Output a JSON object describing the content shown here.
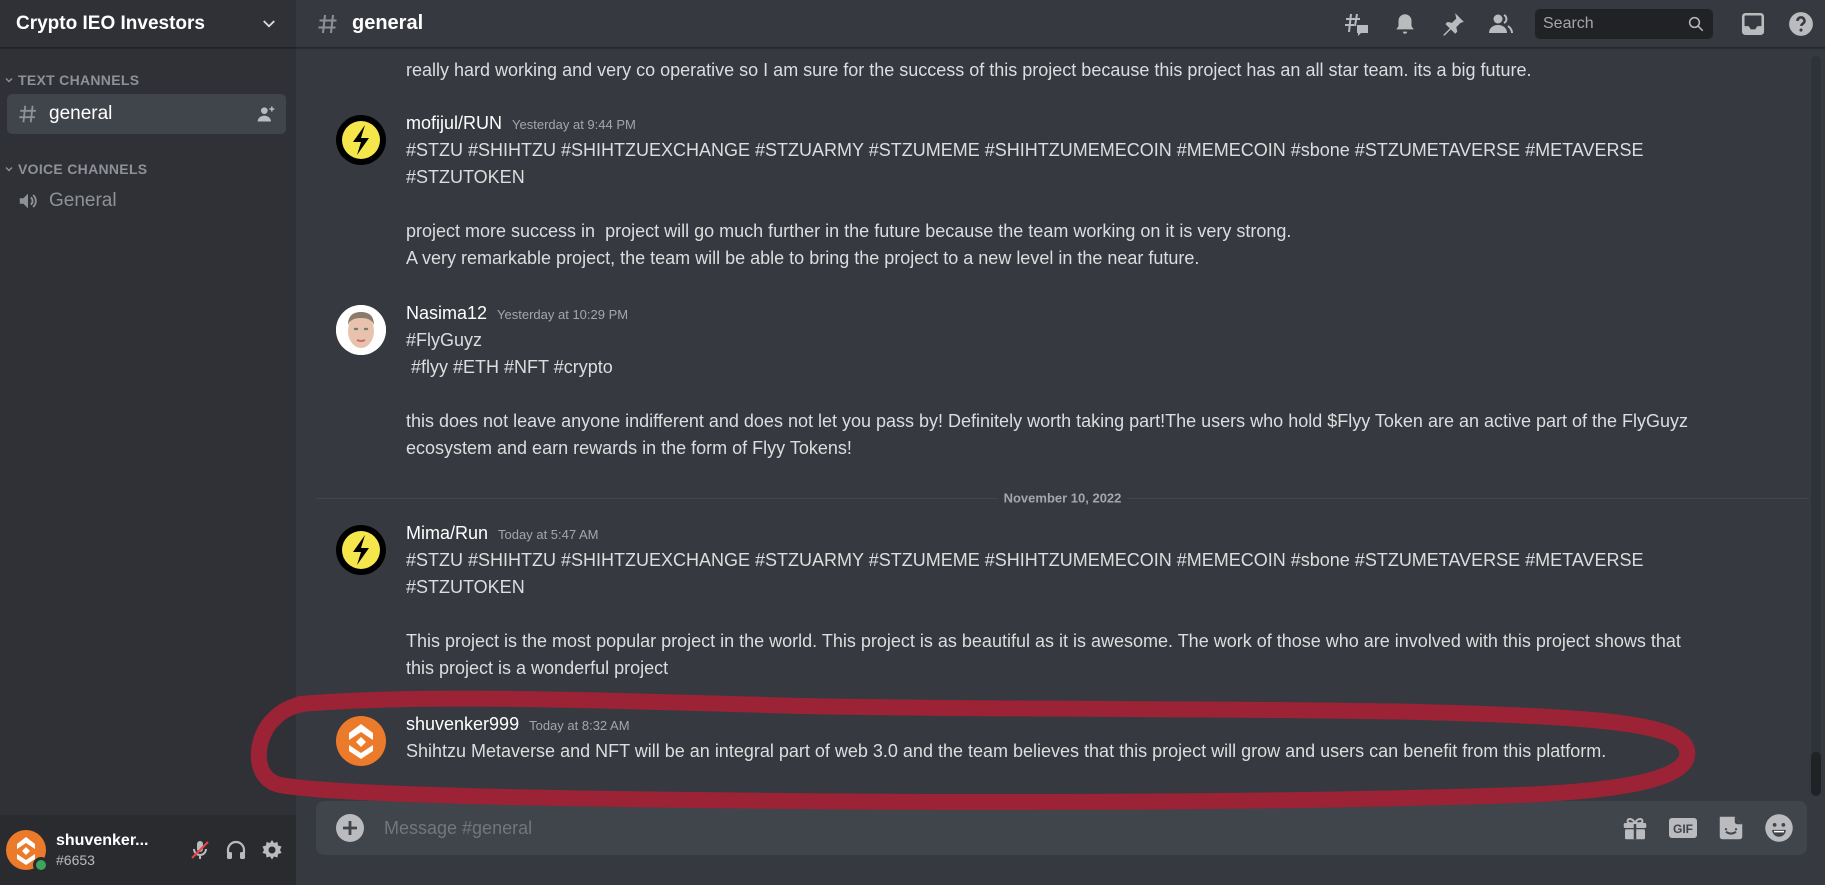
{
  "server": {
    "name": "Crypto IEO Investors"
  },
  "sidebar": {
    "categories": [
      {
        "label": "TEXT CHANNELS"
      },
      {
        "label": "VOICE CHANNELS"
      }
    ],
    "text_channels": [
      {
        "label": "general",
        "active": true
      }
    ],
    "voice_channels": [
      {
        "label": "General"
      }
    ]
  },
  "user_panel": {
    "username": "shuvenker...",
    "tag": "#6653",
    "status": "online"
  },
  "topbar": {
    "channel": "general",
    "icons": [
      "threads-icon",
      "notification-bell-icon",
      "pinned-messages-icon",
      "member-list-icon",
      "inbox-icon",
      "help-icon"
    ],
    "search_placeholder": "Search"
  },
  "messages": [
    {
      "continuation": true,
      "lines": [
        "really hard working and very co operative so I am sure for the success of this project because this project has an all star team. its a big future."
      ]
    },
    {
      "author": "mofijul/RUN",
      "time": "Yesterday at 9:44 PM",
      "avatar": "lightning-bolt",
      "lines": [
        "#STZU #SHIHTZU #SHIHTZUEXCHANGE #STZUARMY #STZUMEME #SHIHTZUMEMECOIN #MEMECOIN #sbone #STZUMETAVERSE #METAVERSE",
        "#STZUTOKEN",
        "",
        "project more success in  project will go much further in the future because the team working on it is very strong.",
        "A very remarkable project, the team will be able to bring the project to a new level in the near future."
      ]
    },
    {
      "author": "Nasima12",
      "time": "Yesterday at 10:29 PM",
      "avatar": "face-photo",
      "lines": [
        "#FlyGuyz",
        " #flyy #ETH #NFT #crypto",
        "",
        "this does not leave anyone indifferent and does not let you pass by! Definitely worth taking part!The users who hold $Flyy Token are an active part of the FlyGuyz",
        "ecosystem and earn rewards in the form of Flyy Tokens!"
      ]
    },
    {
      "author": "Mima/Run",
      "time": "Today at 5:47 AM",
      "avatar": "lightning-bolt",
      "lines": [
        "#STZU #SHIHTZU #SHIHTZUEXCHANGE #STZUARMY #STZUMEME #SHIHTZUMEMECOIN #MEMECOIN #sbone #STZUMETAVERSE #METAVERSE",
        "#STZUTOKEN",
        "",
        "This project is the most popular project in the world. This project is as beautiful as it is awesome. The work of those who are involved with this project shows that",
        "this project is a wonderful project"
      ]
    },
    {
      "author": "shuvenker999",
      "time": "Today at 8:32 AM",
      "avatar": "orange-logo",
      "highlighted": true,
      "lines": [
        "Shihtzu Metaverse and NFT will be an integral part of web 3.0 and the team believes that this project will grow and users can benefit from this platform."
      ]
    }
  ],
  "date_divider": "November 10, 2022",
  "composer": {
    "placeholder": "Message #general",
    "gif_label": "GIF"
  },
  "colors": {
    "annotation": "#9b2335",
    "online": "#3ba55d",
    "bolt_yellow": "#f5e64b",
    "avatar_orange": "#ec7a2b"
  }
}
